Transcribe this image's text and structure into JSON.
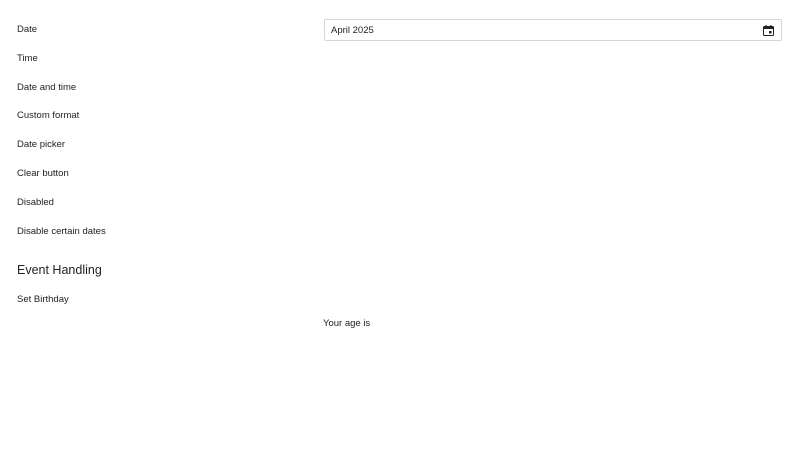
{
  "rows": [
    {
      "label": "Date"
    },
    {
      "label": "Time"
    },
    {
      "label": "Date and time"
    },
    {
      "label": "Custom format"
    },
    {
      "label": "Date picker"
    },
    {
      "label": "Clear button"
    },
    {
      "label": "Disabled"
    },
    {
      "label": "Disable certain dates"
    }
  ],
  "date_input": {
    "value": "April 2025",
    "icon": "calendar-icon"
  },
  "event_section": {
    "heading": "Event Handling",
    "birthday_label": "Set Birthday",
    "age_text": "Your age is"
  }
}
